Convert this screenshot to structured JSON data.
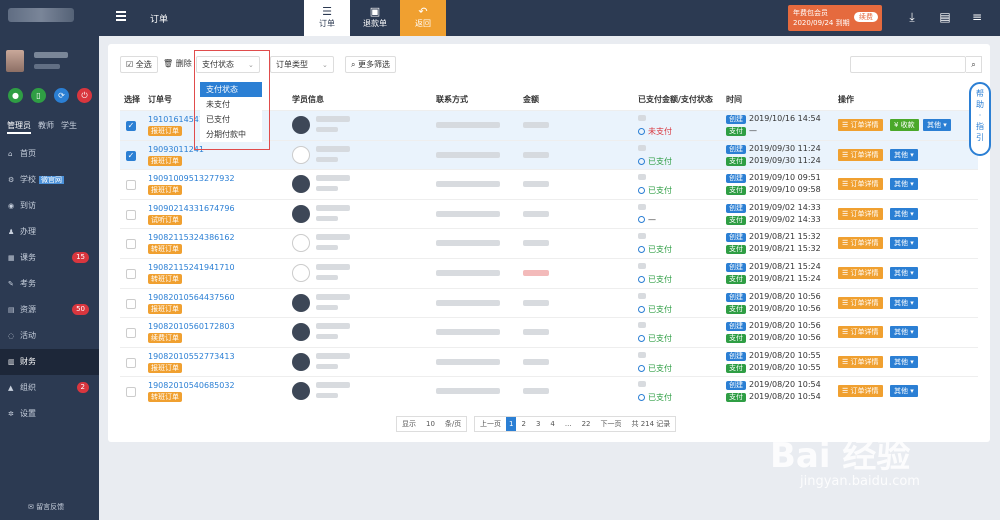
{
  "topbar": {
    "title": "订单",
    "tabs": [
      {
        "label": "订单",
        "icon": "list-icon"
      },
      {
        "label": "退款单",
        "icon": "refund-icon"
      },
      {
        "label": "返回",
        "icon": "back-arrow-icon"
      }
    ],
    "badge_line1": "年费包会员",
    "badge_line2": "2020/09/24 到期",
    "renew_label": "续费"
  },
  "sidebar": {
    "roles": [
      "管理员",
      "教师",
      "学生"
    ],
    "items": [
      {
        "label": "首页",
        "icon": "home-icon"
      },
      {
        "label": "学校",
        "icon": "school-icon",
        "tag": "微官网"
      },
      {
        "label": "到访",
        "icon": "eye-icon"
      },
      {
        "label": "办理",
        "icon": "user-icon"
      },
      {
        "label": "课务",
        "icon": "calendar-icon",
        "badge": "15"
      },
      {
        "label": "考务",
        "icon": "exam-icon"
      },
      {
        "label": "资源",
        "icon": "resource-icon",
        "badge": "50"
      },
      {
        "label": "活动",
        "icon": "activity-icon"
      },
      {
        "label": "财务",
        "icon": "finance-icon"
      },
      {
        "label": "组织",
        "icon": "org-icon",
        "badge": "2"
      },
      {
        "label": "设置",
        "icon": "gear-icon"
      }
    ],
    "feedback": "留言反馈"
  },
  "toolbar": {
    "select_all": "全选",
    "delete": "删除",
    "pay_status": "支付状态",
    "order_type": "订单类型",
    "more_filter": "更多筛选"
  },
  "dropdown": {
    "options": [
      "支付状态",
      "未支付",
      "已支付",
      "分期付款中"
    ],
    "selected": "支付状态"
  },
  "table": {
    "headers": [
      "选择",
      "订单号",
      "学员信息",
      "联系方式",
      "金额",
      "已支付金额/支付状态",
      "时间",
      "操作"
    ],
    "rows": [
      {
        "order": "19101614541",
        "tag": "报班订单",
        "checked": true,
        "pay": "未支付",
        "created": "2019/10/16 14:54",
        "paid": "—",
        "collect": true
      },
      {
        "order": "19093011241",
        "tag": "报班订单",
        "checked": true,
        "pay": "已支付",
        "created": "2019/09/30 11:24",
        "paid": "2019/09/30 11:24",
        "collect": false
      },
      {
        "order": "19091009513277932",
        "tag": "报班订单",
        "checked": false,
        "pay": "已支付",
        "created": "2019/09/10 09:51",
        "paid": "2019/09/10 09:58",
        "collect": false
      },
      {
        "order": "19090214331674796",
        "tag": "试听订单",
        "checked": false,
        "pay": "—",
        "created": "2019/09/02 14:33",
        "paid": "2019/09/02 14:33",
        "collect": false
      },
      {
        "order": "19082115324386162",
        "tag": "转班订单",
        "checked": false,
        "pay": "已支付",
        "created": "2019/08/21 15:32",
        "paid": "2019/08/21 15:32",
        "collect": false
      },
      {
        "order": "19082115241941710",
        "tag": "转班订单",
        "checked": false,
        "pay": "已支付",
        "created": "2019/08/21 15:24",
        "paid": "2019/08/21 15:24",
        "collect": false
      },
      {
        "order": "19082010564437560",
        "tag": "报班订单",
        "checked": false,
        "pay": "已支付",
        "created": "2019/08/20 10:56",
        "paid": "2019/08/20 10:56",
        "collect": false
      },
      {
        "order": "19082010560172803",
        "tag": "续费订单",
        "checked": false,
        "pay": "已支付",
        "created": "2019/08/20 10:56",
        "paid": "2019/08/20 10:56",
        "collect": false
      },
      {
        "order": "19082010552773413",
        "tag": "报班订单",
        "checked": false,
        "pay": "已支付",
        "created": "2019/08/20 10:55",
        "paid": "2019/08/20 10:55",
        "collect": false
      },
      {
        "order": "19082010540685032",
        "tag": "转班订单",
        "checked": false,
        "pay": "已支付",
        "created": "2019/08/20 10:54",
        "paid": "2019/08/20 10:54",
        "collect": false
      }
    ],
    "status_create": "创建",
    "status_pay": "支付",
    "detail_label": "订单详情",
    "collect_label": "¥ 收款",
    "more_label": "其他"
  },
  "pager": {
    "show": "显示",
    "page_size": "10",
    "per_page": "条/页",
    "prev": "上一页",
    "pages": [
      "1",
      "2",
      "3",
      "4",
      "...",
      "22"
    ],
    "next": "下一页",
    "total": "共 214 记录"
  },
  "help": [
    "帮",
    "助",
    "·",
    "指",
    "引"
  ],
  "watermark": {
    "main": "Bai 经验",
    "sub": "jingyan.baidu.com"
  },
  "colors": {
    "sidebar": "#2c3a52",
    "accent": "#2b7fd4",
    "orange": "#f0a030",
    "green": "#2f9e44",
    "red": "#d9363e"
  }
}
